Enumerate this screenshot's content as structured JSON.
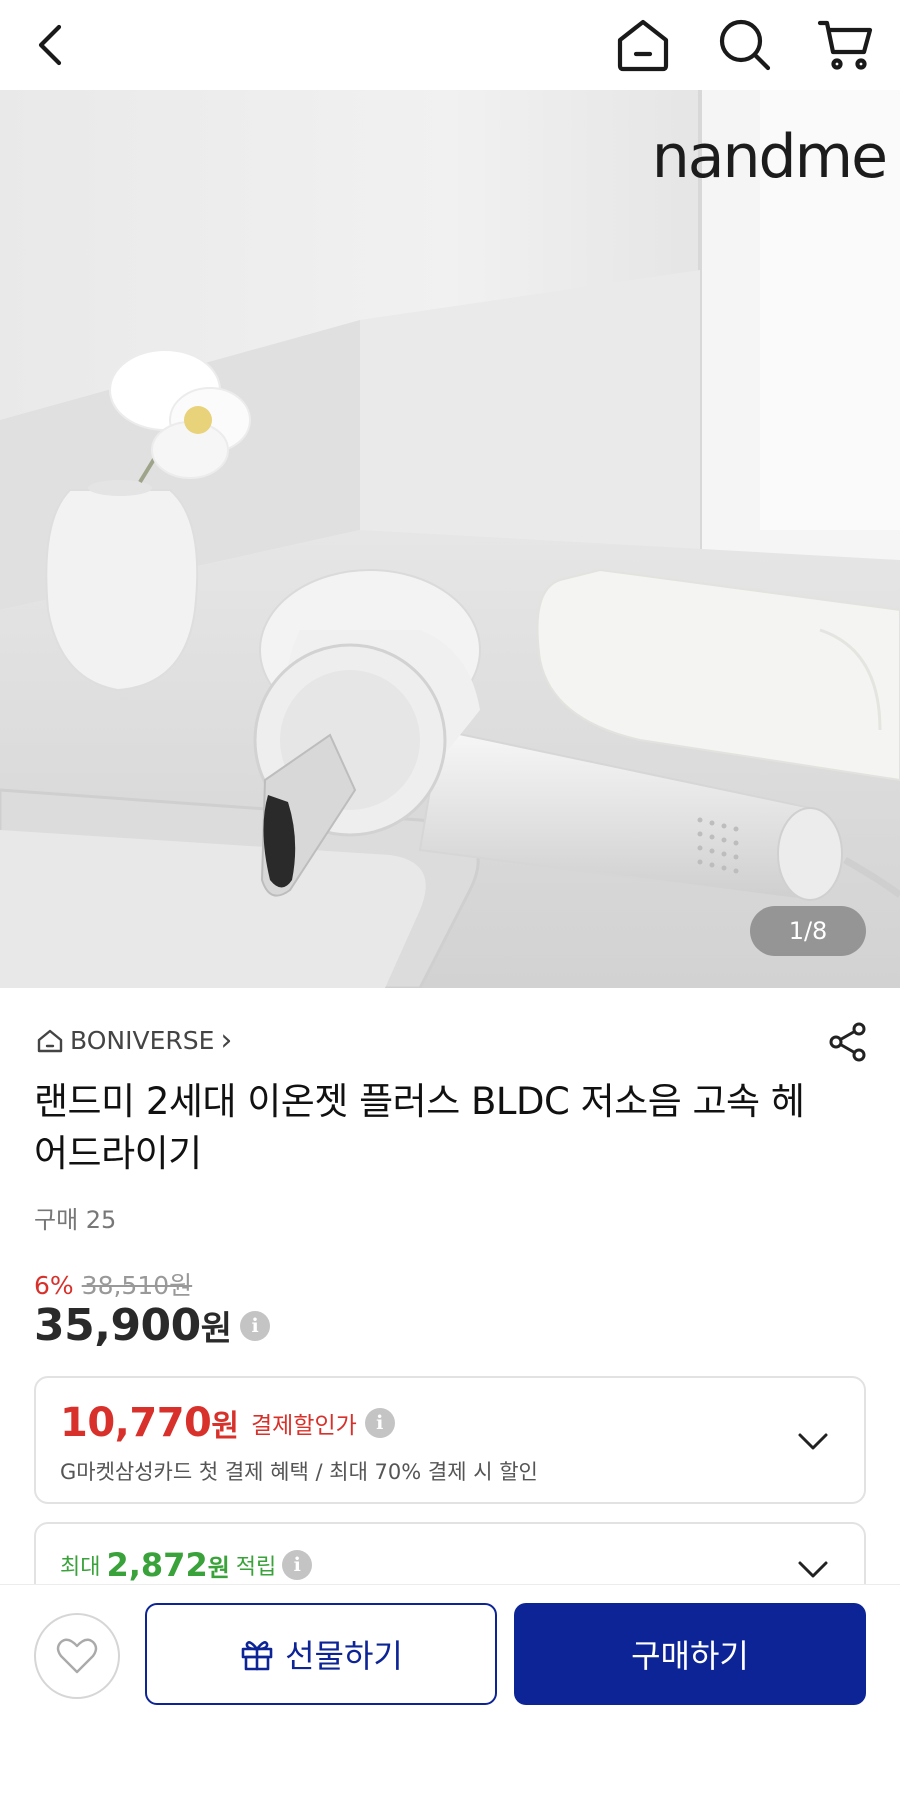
{
  "header": {
    "icons": [
      "back-icon",
      "home-icon",
      "search-icon",
      "cart-icon"
    ]
  },
  "gallery": {
    "brand_logo": "nandme",
    "page_indicator": "1/8"
  },
  "product": {
    "seller": "BONIVERSE",
    "seller_chevron": "›",
    "title": "랜드미 2세대 이온젯 플러스 BLDC 저소음 고속 헤어드라이기",
    "purchase_count": "구매 25",
    "discount_rate": "6%",
    "original_price": "38,510원",
    "price": "35,900",
    "price_unit": "원"
  },
  "payment_discount": {
    "amount": "10,770",
    "unit": "원",
    "label": "결제할인가",
    "description": "G마켓삼성카드 첫 결제 혜택 / 최대 70% 결제 시 할인"
  },
  "reward": {
    "prefix": "최대",
    "amount": "2,872",
    "unit": "원",
    "label": "적립"
  },
  "bottom_bar": {
    "gift_label": "선물하기",
    "buy_label": "구매하기"
  },
  "colors": {
    "accent_blue": "#0c2496",
    "discount_red": "#d8312b",
    "reward_green": "#3aa23a"
  }
}
